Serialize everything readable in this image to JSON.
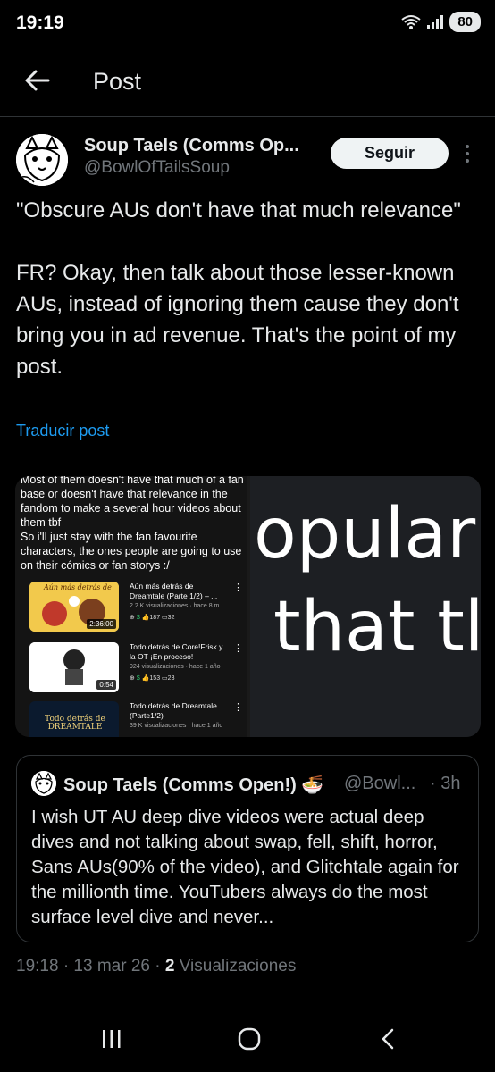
{
  "status_bar": {
    "time": "19:19",
    "battery": "80"
  },
  "header": {
    "title": "Post"
  },
  "author": {
    "name": "Soup Taels (Comms Op...",
    "handle": "@BowlOfTailsSoup"
  },
  "follow_label": "Seguir",
  "post": {
    "text": "\"Obscure AUs don't have that much relevance\"\n\nFR? Okay, then talk about those lesser-known AUs, instead of ignoring them cause they don't bring you in ad revenue. That's the point of my post.",
    "translate": "Traducir post"
  },
  "media": {
    "screenshot_text": "Most of them doesn't have that much of a fan base or doesn't have that relevance in the fandom to make a several hour videos about them tbf\nSo i'll just stay with the fan favourite characters, the ones people are going to use on their cómics or fan storys :/",
    "videos": [
      {
        "thumb_text": "Aún más detrás de",
        "duration": "2:36:00",
        "title": "Aún más detrás de Dreamtale (Parte 1/2) – ...",
        "meta": "2.2 K visualizaciones · hace 8 m...",
        "likes": "187",
        "comments": "32"
      },
      {
        "thumb_text": "",
        "duration": "0:54",
        "title": "Todo detrás de Core!Frisk y la OT ¡En proceso!",
        "meta": "924 visualizaciones · hace 1 año",
        "likes": "153",
        "comments": "23"
      },
      {
        "thumb_text": "Todo detrás de DREAMTALE",
        "duration": "",
        "title": "Todo detrás de Dreamtale (Parte1/2)",
        "meta": "39 K visualizaciones · hace 1 año",
        "likes": "",
        "comments": ""
      }
    ],
    "right_line1": "opular",
    "right_line2": "that tl"
  },
  "quote": {
    "name": "Soup Taels (Comms Open!) 🍜",
    "handle": "@Bowl...",
    "time": "· 3h",
    "text": "I wish UT AU deep dive videos were actual deep dives and not talking about swap, fell, shift, horror, Sans AUs(90% of the video), and Glitchtale again for the millionth time. YouTubers always do the most surface level dive and never..."
  },
  "post_meta": {
    "time_date": "19:18 · 13 mar 26 · ",
    "views_count": "2",
    "views_label": " Visualizaciones"
  },
  "colors": {
    "background": "#000000",
    "link": "#1d9bf0",
    "muted": "#71767b",
    "text": "#e7e9ea",
    "divider": "#2f3336"
  }
}
